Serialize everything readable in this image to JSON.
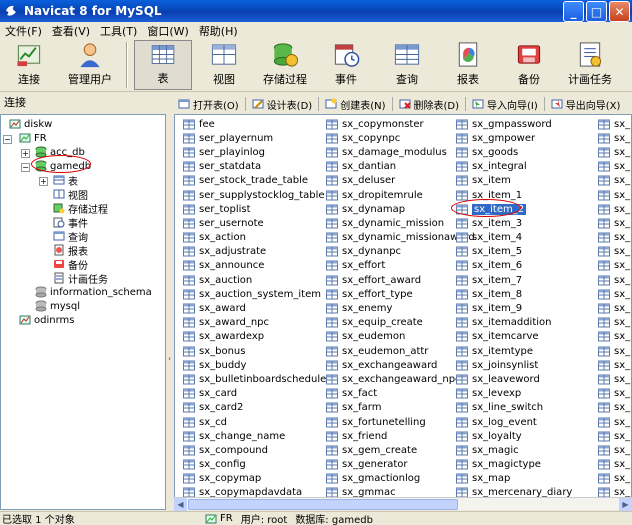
{
  "window": {
    "title": "Navicat 8 for MySQL"
  },
  "menu": [
    "文件(F)",
    "查看(V)",
    "工具(T)",
    "窗口(W)",
    "帮助(H)"
  ],
  "toolbar": [
    {
      "label": "连接",
      "icon": "connect-icon"
    },
    {
      "label": "管理用户",
      "icon": "user-icon"
    },
    {
      "label": "表",
      "icon": "table-icon",
      "active": true
    },
    {
      "label": "视图",
      "icon": "view-icon"
    },
    {
      "label": "存储过程",
      "icon": "procedure-icon"
    },
    {
      "label": "事件",
      "icon": "event-icon"
    },
    {
      "label": "查询",
      "icon": "query-icon"
    },
    {
      "label": "报表",
      "icon": "report-icon"
    },
    {
      "label": "备份",
      "icon": "backup-icon"
    },
    {
      "label": "计画任务",
      "icon": "schedule-icon"
    }
  ],
  "left_panel": {
    "header": "连接"
  },
  "tree": [
    {
      "label": "diskw",
      "level": 0,
      "icon": "connection-icon"
    },
    {
      "label": "FR",
      "level": 0,
      "icon": "connection-icon",
      "expanded": true
    },
    {
      "label": "acc_db",
      "level": 1,
      "icon": "database-icon"
    },
    {
      "label": "gamedb",
      "level": 1,
      "icon": "database-open-icon",
      "expanded": true,
      "highlighted": true
    },
    {
      "label": "表",
      "level": 2,
      "icon": "table-icon"
    },
    {
      "label": "视图",
      "level": 2,
      "icon": "view-icon"
    },
    {
      "label": "存储过程",
      "level": 2,
      "icon": "procedure-icon"
    },
    {
      "label": "事件",
      "level": 2,
      "icon": "event-icon"
    },
    {
      "label": "查询",
      "level": 2,
      "icon": "query-icon"
    },
    {
      "label": "报表",
      "level": 2,
      "icon": "report-icon"
    },
    {
      "label": "备份",
      "level": 2,
      "icon": "backup-icon"
    },
    {
      "label": "计画任务",
      "level": 2,
      "icon": "schedule-icon"
    },
    {
      "label": "information_schema",
      "level": 1,
      "icon": "database-gray-icon"
    },
    {
      "label": "mysql",
      "level": 1,
      "icon": "database-gray-icon"
    },
    {
      "label": "odinrms",
      "level": 0,
      "icon": "connection-icon"
    }
  ],
  "object_toolbar": [
    {
      "label": "打开表(O)",
      "icon": "open-table-icon"
    },
    {
      "label": "设计表(D)",
      "icon": "design-table-icon"
    },
    {
      "label": "创建表(N)",
      "icon": "new-table-icon"
    },
    {
      "label": "删除表(D)",
      "icon": "delete-table-icon"
    },
    {
      "label": "导入向导(I)",
      "icon": "import-icon"
    },
    {
      "label": "导出向导(X)",
      "icon": "export-icon"
    }
  ],
  "tables": {
    "col1": [
      "fee",
      "ser_playernum",
      "ser_playinlog",
      "ser_statdata",
      "ser_stock_trade_table",
      "ser_supplystocklog_table",
      "ser_toplist",
      "ser_usernote",
      "sx_action",
      "sx_adjustrate",
      "sx_announce",
      "sx_auction",
      "sx_auction_system_item",
      "sx_award",
      "sx_award_npc",
      "sx_awardexp",
      "sx_bonus",
      "sx_buddy",
      "sx_bulletinboardschedule",
      "sx_card",
      "sx_card2",
      "sx_cd",
      "sx_change_name",
      "sx_compound",
      "sx_config",
      "sx_copymap",
      "sx_copymapdavdata"
    ],
    "col2": [
      "sx_copymonster",
      "sx_copynpc",
      "sx_damage_modulus",
      "sx_dantian",
      "sx_deluser",
      "sx_dropitemrule",
      "sx_dynamap",
      "sx_dynamic_mission",
      "sx_dynamic_missionaward",
      "sx_dynanpc",
      "sx_effort",
      "sx_effort_award",
      "sx_effort_type",
      "sx_enemy",
      "sx_equip_create",
      "sx_eudemon",
      "sx_eudemon_attr",
      "sx_exchangeaward",
      "sx_exchangeaward_npc",
      "sx_fact",
      "sx_farm",
      "sx_fortunetelling",
      "sx_friend",
      "sx_gem_create",
      "sx_generator",
      "sx_gmactionlog",
      "sx_gmmac"
    ],
    "col3": [
      "sx_gmpassword",
      "sx_gmpower",
      "sx_goods",
      "sx_integral",
      "sx_item",
      "sx_item_1",
      "sx_item_2",
      "sx_item_3",
      "sx_item_4",
      "sx_item_5",
      "sx_item_6",
      "sx_item_7",
      "sx_item_8",
      "sx_item_9",
      "sx_itemaddition",
      "sx_itemcarve",
      "sx_itemtype",
      "sx_joinsynlist",
      "sx_leaveword",
      "sx_levexp",
      "sx_line_switch",
      "sx_log_event",
      "sx_loyalty",
      "sx_magic",
      "sx_magictype",
      "sx_map",
      "sx_mercenary_diary"
    ],
    "col4": [
      "sx_r",
      "sx_r",
      "sx_r",
      "sx_r",
      "sx_r",
      "sx_r",
      "sx_p",
      "sx_p",
      "sx_p",
      "sx_p",
      "sx_p",
      "sx_p",
      "sx_p",
      "sx_p",
      "sx_p",
      "sx_p",
      "sx_p",
      "sx_p",
      "sx_p",
      "sx_p",
      "sx_p",
      "sx_r",
      "sx_r",
      "sx_r",
      "sx_r",
      "sx_r",
      "sx_r"
    ],
    "selected": "sx_item_2"
  },
  "status": {
    "selection": "已选取 1 个对象",
    "connection": "FR",
    "user": "用户: root",
    "database": "数据库: gamedb"
  },
  "colors": {
    "selection": "#316ac5",
    "highlight_ring": "#dd0000",
    "title_bar": "#0a5fdc"
  }
}
